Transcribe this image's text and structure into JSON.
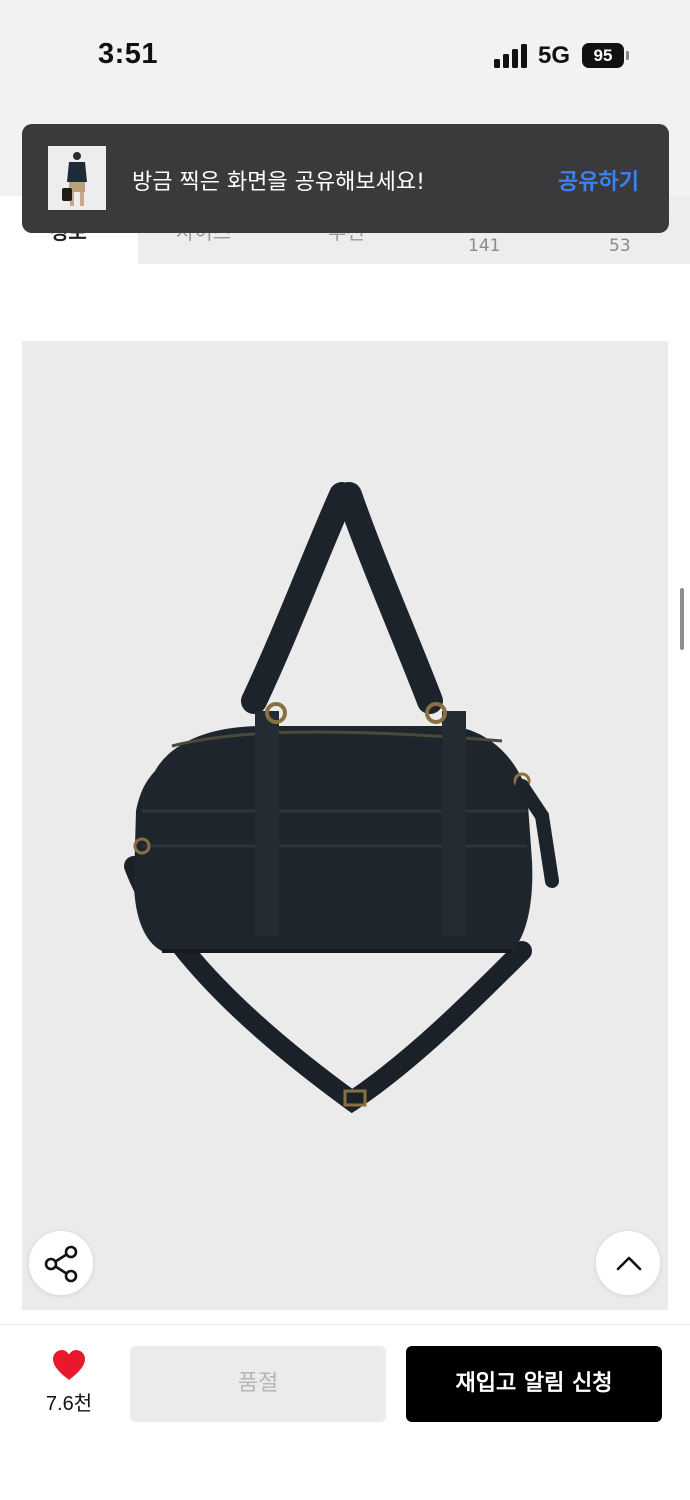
{
  "status_bar": {
    "time": "3:51",
    "network": "5G",
    "battery": "95"
  },
  "tabs": [
    {
      "label": "정보",
      "count": ""
    },
    {
      "label": "사이즈",
      "count": ""
    },
    {
      "label": "추천",
      "count": ""
    },
    {
      "label": "",
      "count": "141"
    },
    {
      "label": "",
      "count": "53"
    }
  ],
  "toast": {
    "message": "방금 찍은 화면을 공유해보세요!",
    "action": "공유하기",
    "thumbnail_icon": "screenshot-thumbnail"
  },
  "product": {
    "image_icon": "black-duffel-bag",
    "background_color": "#ebebeb"
  },
  "actions": {
    "share_icon": "share-icon",
    "scroll_top_icon": "chevron-up-icon"
  },
  "bottom_bar": {
    "like_count": "7.6천",
    "like_color": "#e8192c",
    "soldout_label": "품절",
    "restock_label": "재입고 알림 신청"
  }
}
